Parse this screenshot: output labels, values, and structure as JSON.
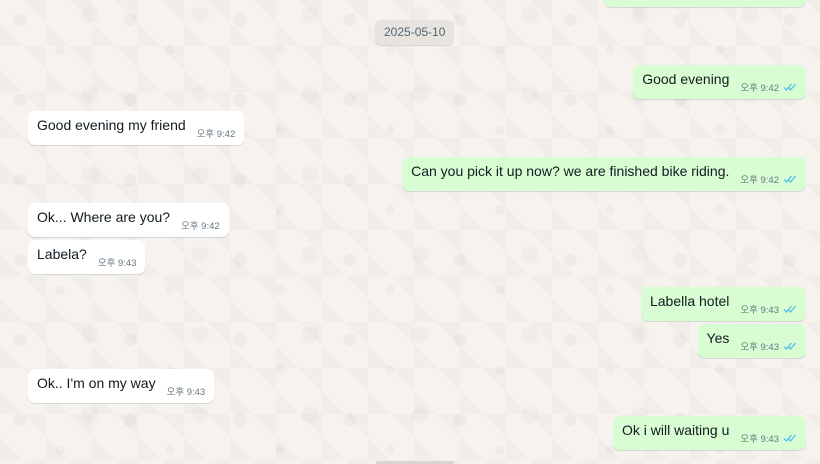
{
  "chat": {
    "date_separator": "2025-05-10",
    "messages": [
      {
        "direction": "out",
        "text": "Good evening",
        "time": "오후 9:42",
        "status": "read"
      },
      {
        "direction": "in",
        "text": "Good evening my friend",
        "time": "오후 9:42"
      },
      {
        "direction": "out",
        "text": "Can you pick it up now? we are finished bike riding.",
        "time": "오후 9:42",
        "status": "read"
      },
      {
        "direction": "in",
        "text": "Ok... Where are you?",
        "time": "오후 9:42"
      },
      {
        "direction": "in",
        "text": "Labela?",
        "time": "오후 9:43"
      },
      {
        "direction": "out",
        "text": "Labella hotel",
        "time": "오후 9:43",
        "status": "read"
      },
      {
        "direction": "out",
        "text": "Yes",
        "time": "오후 9:43",
        "status": "read"
      },
      {
        "direction": "in",
        "text": "Ok.. I'm on my way",
        "time": "오후 9:43"
      },
      {
        "direction": "out",
        "text": "Ok i will waiting u",
        "time": "오후 9:43",
        "status": "read"
      }
    ]
  },
  "colors": {
    "incoming_bubble": "#ffffff",
    "outgoing_bubble": "#d9fdd3",
    "read_tick": "#53bdeb",
    "background": "#efeae2"
  },
  "icons": {
    "read_receipt": "double-check-icon"
  }
}
